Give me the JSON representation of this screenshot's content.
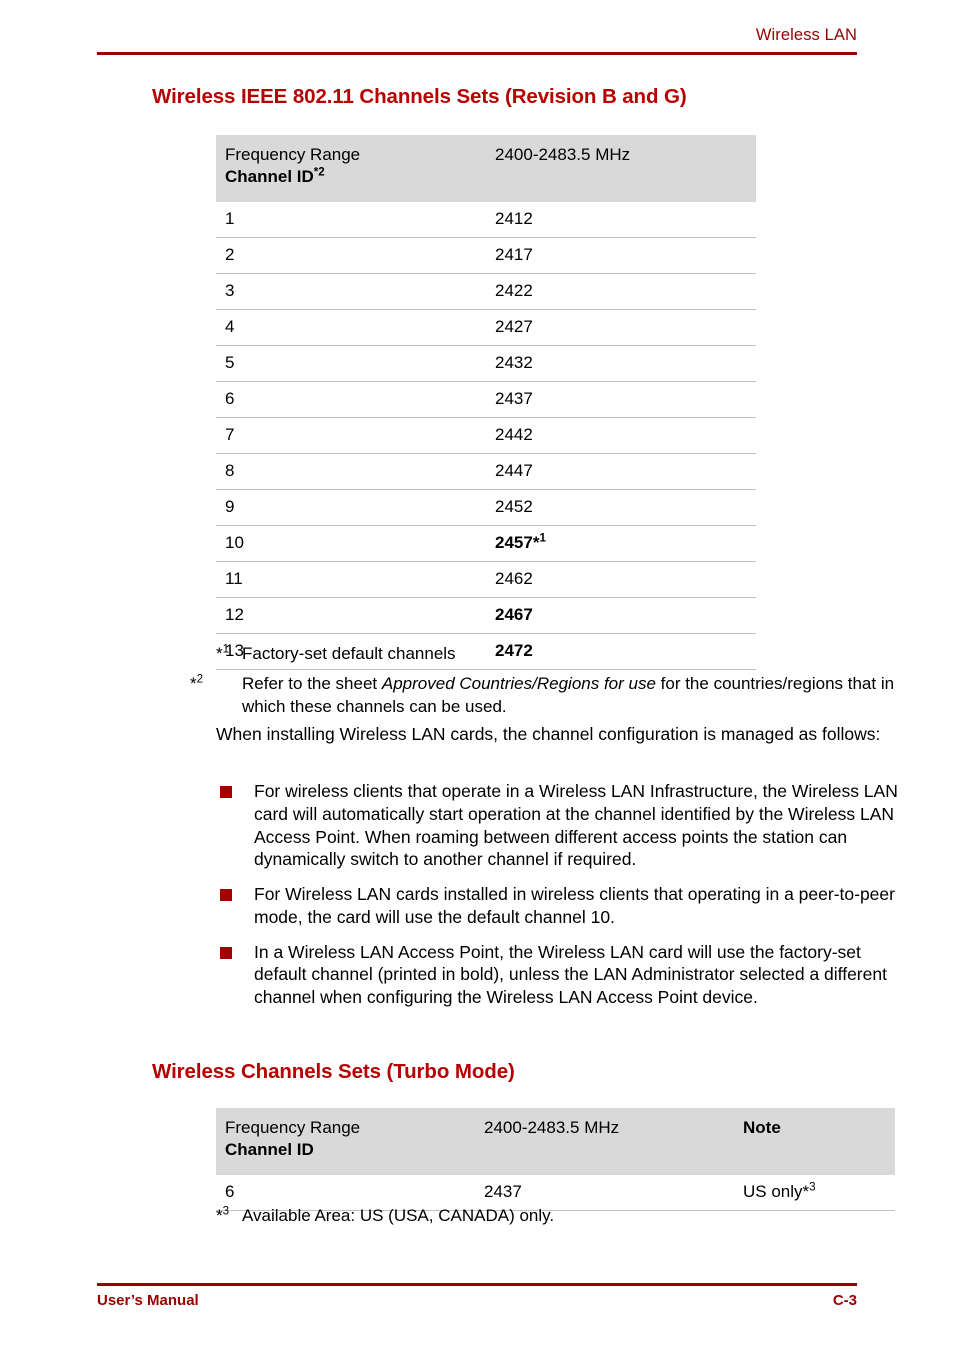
{
  "header": {
    "running_head": "Wireless LAN",
    "rule_color": "#9b0000"
  },
  "footer": {
    "left": "User’s Manual",
    "right": "C-3"
  },
  "sections": {
    "heading_1": "Wireless IEEE 802.11 Channels Sets (Revision B and G)",
    "heading_2": "Wireless Channels Sets (Turbo Mode)",
    "heading_color": "#b70000"
  },
  "table_channels": {
    "header": {
      "col_a_line1": "Frequency Range",
      "col_a_line2": "Channel ID",
      "col_a_line2_sup": "*2",
      "col_b": "2400-2483.5 MHz"
    },
    "rows": [
      {
        "channel": "1",
        "frequency": "2412",
        "bold": false,
        "sup": ""
      },
      {
        "channel": "2",
        "frequency": "2417",
        "bold": false,
        "sup": ""
      },
      {
        "channel": "3",
        "frequency": "2422",
        "bold": false,
        "sup": ""
      },
      {
        "channel": "4",
        "frequency": "2427",
        "bold": false,
        "sup": ""
      },
      {
        "channel": "5",
        "frequency": "2432",
        "bold": false,
        "sup": ""
      },
      {
        "channel": "6",
        "frequency": "2437",
        "bold": false,
        "sup": ""
      },
      {
        "channel": "7",
        "frequency": "2442",
        "bold": false,
        "sup": ""
      },
      {
        "channel": "8",
        "frequency": "2447",
        "bold": false,
        "sup": ""
      },
      {
        "channel": "9",
        "frequency": "2452",
        "bold": false,
        "sup": ""
      },
      {
        "channel": "10",
        "frequency": "2457",
        "bold": true,
        "sup": "*1"
      },
      {
        "channel": "11",
        "frequency": "2462",
        "bold": false,
        "sup": ""
      },
      {
        "channel": "12",
        "frequency": "2467",
        "bold": true,
        "sup": ""
      },
      {
        "channel": "13",
        "frequency": "2472",
        "bold": true,
        "sup": ""
      }
    ]
  },
  "footnotes": {
    "fn1_marker": "*1",
    "fn1_text": "Factory-set default channels",
    "fn2_marker": "*2",
    "fn2_text_before": "Refer to the sheet ",
    "fn2_text_italic": "Approved Countries/Regions for use",
    "fn2_text_after": " for the countries/regions that in which these channels can be used.",
    "fn3_marker": "*3",
    "fn3_text": "Available Area: US (USA, CANADA) only."
  },
  "body": {
    "intro": "When installing Wireless LAN cards, the channel configuration is managed as follows:",
    "bullets": [
      "For wireless clients that operate in a Wireless LAN Infrastructure, the Wireless LAN card will automatically start operation at the channel identified by the Wireless LAN Access Point. When roaming between different access points the station can dynamically switch to another channel if required.",
      "For Wireless LAN cards installed in wireless clients that operating in a peer-to-peer mode, the card will use the default channel 10.",
      "In a Wireless LAN Access Point, the Wireless LAN card will use the factory-set default channel (printed in bold), unless the LAN Administrator selected a different channel when configuring the Wireless LAN Access Point device."
    ],
    "bullet_color": "#a30000"
  },
  "table_turbo": {
    "header": {
      "col_a_line1": "Frequency Range",
      "col_a_line2": "Channel ID",
      "col_b": "2400-2483.5 MHz",
      "col_c": "Note"
    },
    "rows": [
      {
        "channel": "6",
        "frequency": "2437",
        "note": "US only",
        "note_sup": "*3"
      }
    ]
  }
}
